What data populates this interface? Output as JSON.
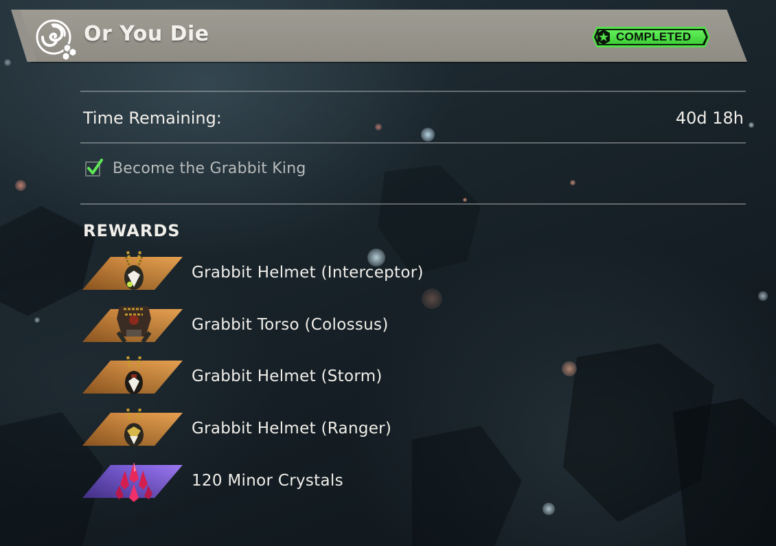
{
  "header": {
    "title": "Or You Die",
    "emblem_icon": "spiral-emblem-icon",
    "status": "COMPLETED",
    "status_icon": "star-badge-icon",
    "status_color": "#53e04a"
  },
  "time": {
    "label": "Time Remaining:",
    "value": "40d 18h"
  },
  "objectives": [
    {
      "text": "Become the Grabbit King",
      "complete": true,
      "icon": "checkmark-icon"
    }
  ],
  "rewards": {
    "heading": "REWARDS",
    "items": [
      {
        "name": "Grabbit Helmet (Interceptor)",
        "rarity_color": "#d48a3a",
        "icon": "helmet-icon"
      },
      {
        "name": "Grabbit Torso (Colossus)",
        "rarity_color": "#d48a3a",
        "icon": "torso-icon"
      },
      {
        "name": "Grabbit Helmet (Storm)",
        "rarity_color": "#d48a3a",
        "icon": "helmet-icon"
      },
      {
        "name": "Grabbit Helmet (Ranger)",
        "rarity_color": "#d48a3a",
        "icon": "helmet-icon"
      },
      {
        "name": "120 Minor Crystals",
        "rarity_color": "#7b5ae0",
        "icon": "crystal-icon"
      }
    ]
  }
}
